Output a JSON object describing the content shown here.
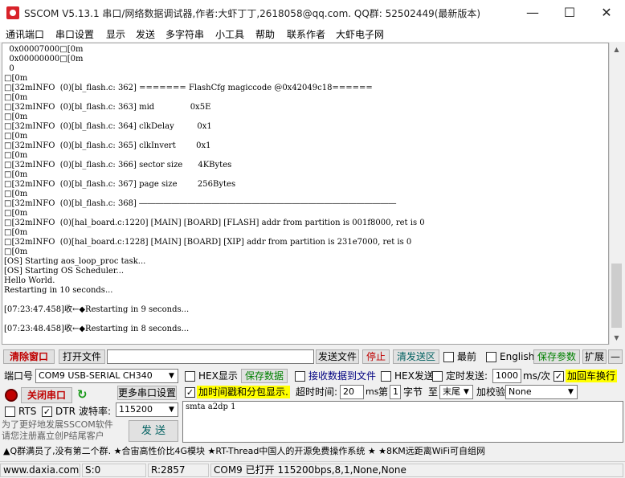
{
  "window": {
    "title": "SSCOM V5.13.1 串口/网络数据调试器,作者:大虾丁丁,2618058@qq.com. QQ群: 52502449(最新版本)",
    "minimize": "—",
    "maximize": "☐",
    "close": "✕"
  },
  "menu": [
    "通讯端口",
    "串口设置",
    "显示",
    "发送",
    "多字符串",
    "小工具",
    "帮助",
    "联系作者",
    "大虾电子网"
  ],
  "terminal": {
    "lines": [
      "  0x00007000□[0m",
      "  0x00000000□[0m",
      "  0",
      "□[0m",
      "□[32mINFO  (0)[bl_flash.c: 362] ======= FlashCfg magiccode @0x42049c18======",
      "□[0m",
      "□[32mINFO  (0)[bl_flash.c: 363] mid              0x5E",
      "□[0m",
      "□[32mINFO  (0)[bl_flash.c: 364] clkDelay         0x1",
      "□[0m",
      "□[32mINFO  (0)[bl_flash.c: 365] clkInvert        0x1",
      "□[0m",
      "□[32mINFO  (0)[bl_flash.c: 366] sector size      4KBytes",
      "□[0m",
      "□[32mINFO  (0)[bl_flash.c: 367] page size        256Bytes",
      "□[0m",
      "□[32mINFO  (0)[bl_flash.c: 368] ――――――――――――――――――――――――――――――――",
      "□[0m",
      "□[32mINFO  (0)[hal_board.c:1220] [MAIN] [BOARD] [FLASH] addr from partition is 001f8000, ret is 0",
      "□[0m",
      "□[32mINFO  (0)[hal_board.c:1228] [MAIN] [BOARD] [XIP] addr from partition is 231e7000, ret is 0",
      "□[0m",
      "[OS] Starting aos_loop_proc task...",
      "[OS] Starting OS Scheduler...",
      "Hello World.",
      "Restarting in 10 seconds...",
      "",
      "[07:23:47.458]收←◆Restarting in 9 seconds...",
      "",
      "[07:23:48.458]收←◆Restarting in 8 seconds...",
      ""
    ]
  },
  "toolbar1": {
    "clear_window": "清除窗口",
    "open_file": "打开文件",
    "send_file": "发送文件",
    "stop": "停止",
    "clear_send": "清发送区",
    "front": "最前",
    "english": "English",
    "save_params": "保存参数",
    "expand": "扩展",
    "collapse": "—"
  },
  "row2": {
    "port_label": "端口号",
    "port_value": "COM9 USB-SERIAL CH340",
    "hex_display": "HEX显示",
    "save_data": "保存数据",
    "recv_to_file": "接收数据到文件",
    "hex_send": "HEX发送",
    "timed_send": "定时发送:",
    "interval": "1000",
    "interval_unit": "ms/次",
    "add_crlf": "加回车换行"
  },
  "row3": {
    "close_port": "关闭串口",
    "more_settings": "更多串口设置",
    "timestamp": "加时间戳和分包显示.",
    "timeout_label": "超时时间:",
    "timeout_value": "20",
    "timeout_unit": "ms",
    "byte_label_1": "第",
    "byte_value": "1",
    "byte_label_2": "字节",
    "to_label": "至",
    "to_value": "末尾",
    "checksum_label": "加校验",
    "checksum_value": "None"
  },
  "row4": {
    "rts": "RTS",
    "dtr": "DTR",
    "baud_label": "波特率:",
    "baud_value": "115200"
  },
  "send": {
    "text": "smta a2dp 1",
    "button": "发 送",
    "promo_line1": "为了更好地发展SSCOM软件",
    "promo_line2": "请您注册嘉立创P结尾客户"
  },
  "ticker": "▲Q群满员了,没有第二个群. ★合宙高性价比4G模块 ★RT-Thread中国人的开源免费操作系统 ★ ★8KM远距离WiFi可自组网",
  "status": {
    "site": "www.daxia.com",
    "sent": "S:0",
    "received": "R:2857",
    "port_status": "COM9 已打开  115200bps,8,1,None,None"
  },
  "colors": {
    "accent_red": "#c00000",
    "accent_green": "#008000",
    "highlight_yellow": "#ffff00"
  }
}
